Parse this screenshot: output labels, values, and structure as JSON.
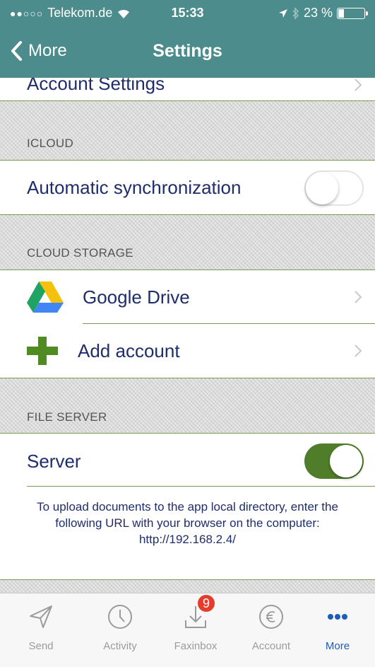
{
  "status_bar": {
    "signal": "●●○○○",
    "carrier": "Telekom.de",
    "time": "15:33",
    "battery": "23 %"
  },
  "nav": {
    "back_label": "More",
    "title": "Settings"
  },
  "top_partial_row": "Account Settings",
  "icloud": {
    "header": "ICLOUD",
    "auto_sync_label": "Automatic synchronization",
    "auto_sync_on": false
  },
  "cloud_storage": {
    "header": "CLOUD STORAGE",
    "items": [
      {
        "label": "Google Drive",
        "icon": "google-drive-icon"
      },
      {
        "label": "Add account",
        "icon": "plus-icon"
      }
    ]
  },
  "file_server": {
    "header": "FILE SERVER",
    "server_label": "Server",
    "server_on": true,
    "note": "To upload documents to the app local directory, enter the following URL with your browser on the computer:",
    "url": "http://192.168.2.4/"
  },
  "tabbar": {
    "tabs": [
      {
        "label": "Send",
        "icon": "send-icon"
      },
      {
        "label": "Activity",
        "icon": "clock-icon"
      },
      {
        "label": "Faxinbox",
        "icon": "inbox-download-icon",
        "badge": "9"
      },
      {
        "label": "Account",
        "icon": "euro-icon"
      },
      {
        "label": "More",
        "icon": "more-dots-icon",
        "active": true
      }
    ]
  },
  "colors": {
    "nav_bg": "#4d8c8c",
    "text_dark_blue": "#1f2d6b",
    "toggle_on": "#4f7d2a",
    "badge": "#e53b2c",
    "active_tab": "#1f5bb8"
  }
}
